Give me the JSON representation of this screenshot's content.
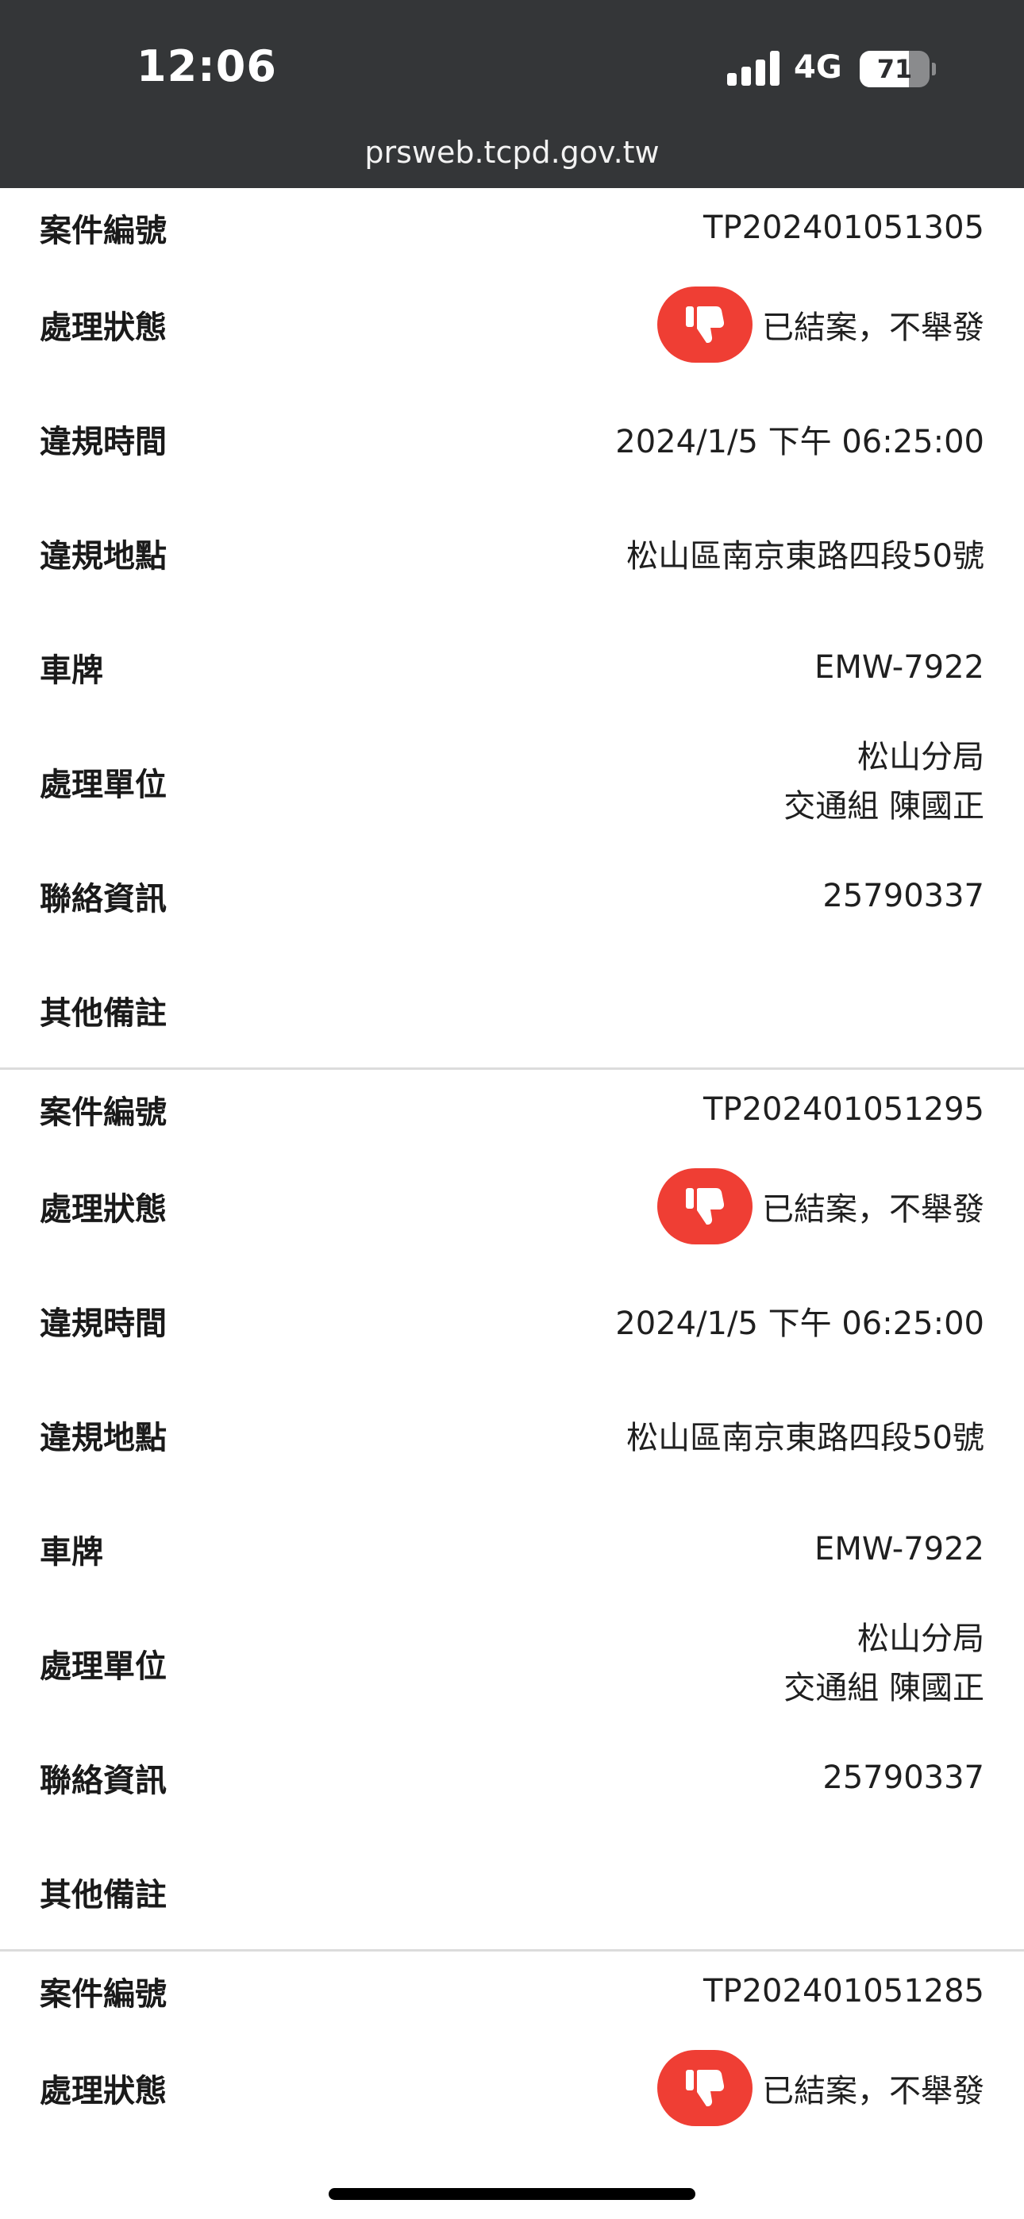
{
  "status_bar": {
    "time": "12:06",
    "network": "4G",
    "battery_level": "71",
    "battery_fraction": 0.71
  },
  "browser": {
    "url": "prsweb.tcpd.gov.tw"
  },
  "labels": {
    "case_number": "案件編號",
    "status": "處理狀態",
    "violation_time": "違規時間",
    "violation_location": "違規地點",
    "plate": "車牌",
    "handling_unit": "處理單位",
    "contact": "聯絡資訊",
    "remarks": "其他備註"
  },
  "cases": [
    {
      "case_number": "TP202401051305",
      "status": "已結案，不舉發",
      "violation_time": "2024/1/5 下午 06:25:00",
      "violation_location": "松山區南京東路四段50號",
      "plate": "EMW-7922",
      "handling_unit_line1": "松山分局",
      "handling_unit_line2": "交通組 陳國正",
      "contact": "25790337",
      "remarks": ""
    },
    {
      "case_number": "TP202401051295",
      "status": "已結案，不舉發",
      "violation_time": "2024/1/5 下午 06:25:00",
      "violation_location": "松山區南京東路四段50號",
      "plate": "EMW-7922",
      "handling_unit_line1": "松山分局",
      "handling_unit_line2": "交通組 陳國正",
      "contact": "25790337",
      "remarks": ""
    },
    {
      "case_number": "TP202401051285",
      "status": "已結案，不舉發"
    }
  ],
  "colors": {
    "status_bar_bg": "#343638",
    "status_icon_bg": "#ef3e34"
  },
  "icons": {
    "status_icon": "thumbs-down-icon"
  }
}
